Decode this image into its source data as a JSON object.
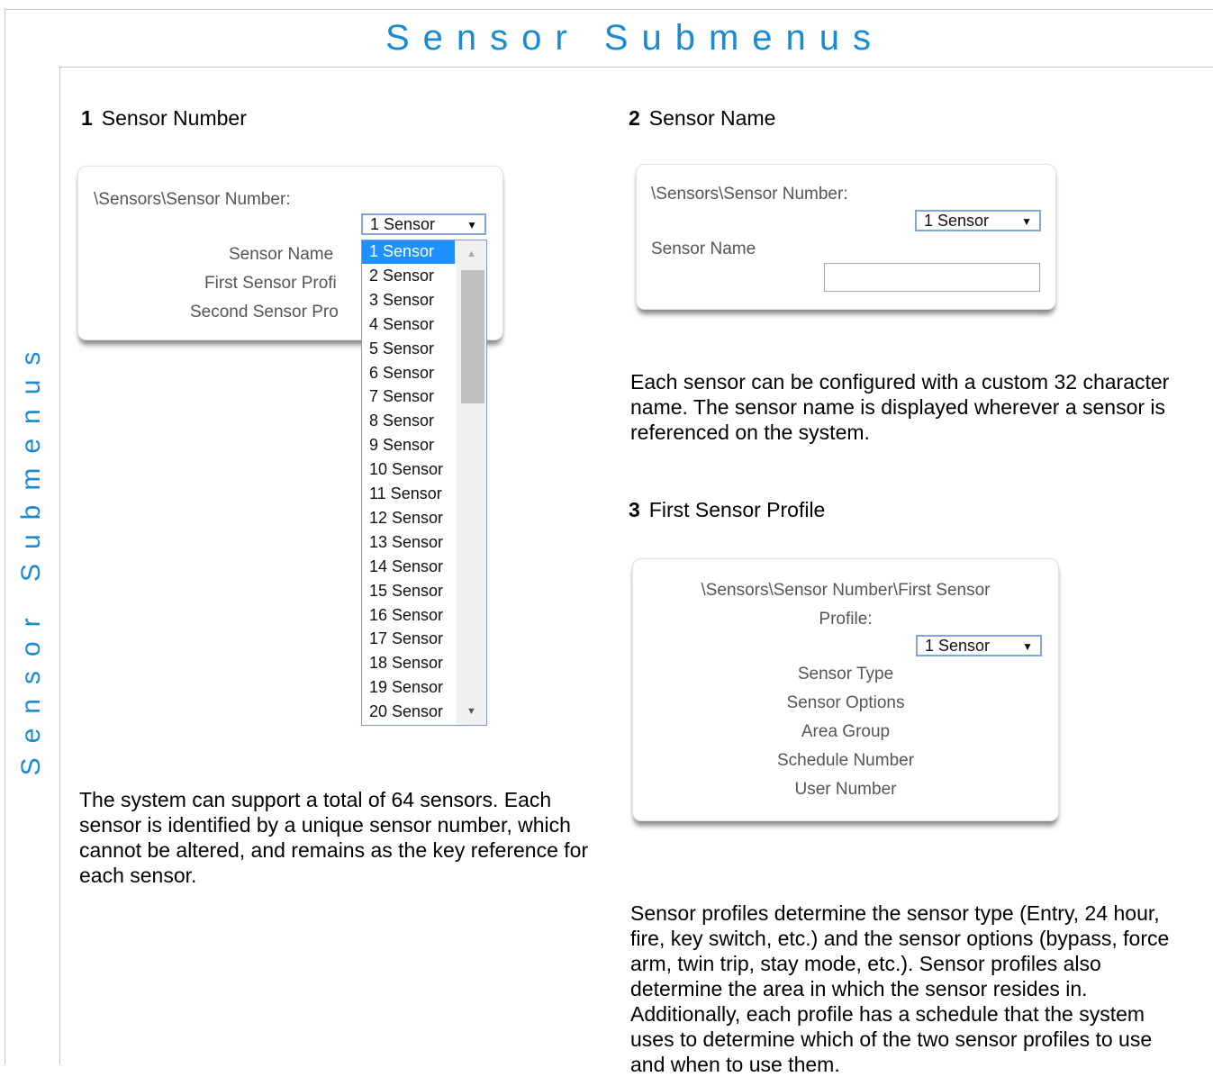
{
  "title": "Sensor Submenus",
  "side_title": "Sensor Submenus",
  "section1": {
    "number": "1",
    "heading": "Sensor Number",
    "panel": {
      "path": "\\Sensors\\Sensor Number:",
      "select_value": "1 Sensor",
      "items": [
        "Sensor Name",
        "First Sensor Profi",
        "Second Sensor Pro"
      ]
    },
    "dropdown_options": [
      "1 Sensor",
      "2 Sensor",
      "3 Sensor",
      "4 Sensor",
      "5 Sensor",
      "6 Sensor",
      "7 Sensor",
      "8 Sensor",
      "9 Sensor",
      "10 Sensor",
      "11 Sensor",
      "12 Sensor",
      "13 Sensor",
      "14 Sensor",
      "15 Sensor",
      "16 Sensor",
      "17 Sensor",
      "18 Sensor",
      "19 Sensor",
      "20 Sensor"
    ],
    "description": "The system can support a total of 64 sensors. Each sensor is identified by a unique sensor number, which cannot be altered, and remains as the key reference for each sensor."
  },
  "section2": {
    "number": "2",
    "heading": "Sensor Name",
    "panel": {
      "path": "\\Sensors\\Sensor Number:",
      "select_value": "1 Sensor",
      "label": "Sensor Name",
      "input_value": ""
    },
    "description": "Each sensor can be configured with a custom 32 character name. The sensor name is displayed wherever a sensor is referenced on the system."
  },
  "section3": {
    "number": "3",
    "heading": "First Sensor Profile",
    "panel": {
      "path_line1": "\\Sensors\\Sensor Number\\First Sensor",
      "path_line2": "Profile:",
      "select_value": "1 Sensor",
      "items": [
        "Sensor Type",
        "Sensor Options",
        "Area Group",
        "Schedule Number",
        "User Number"
      ]
    },
    "description": "Sensor profiles determine the sensor type (Entry, 24 hour, fire, key switch, etc.) and the sensor options (bypass, force arm, twin trip, stay mode, etc.). Sensor profiles also determine the area in which the sensor resides in. Additionally, each profile has a schedule that the system uses to determine which of the two sensor profiles to use and when to use them."
  },
  "colors": {
    "accent": "#1a8bd0",
    "selected": "#1e90ff"
  }
}
